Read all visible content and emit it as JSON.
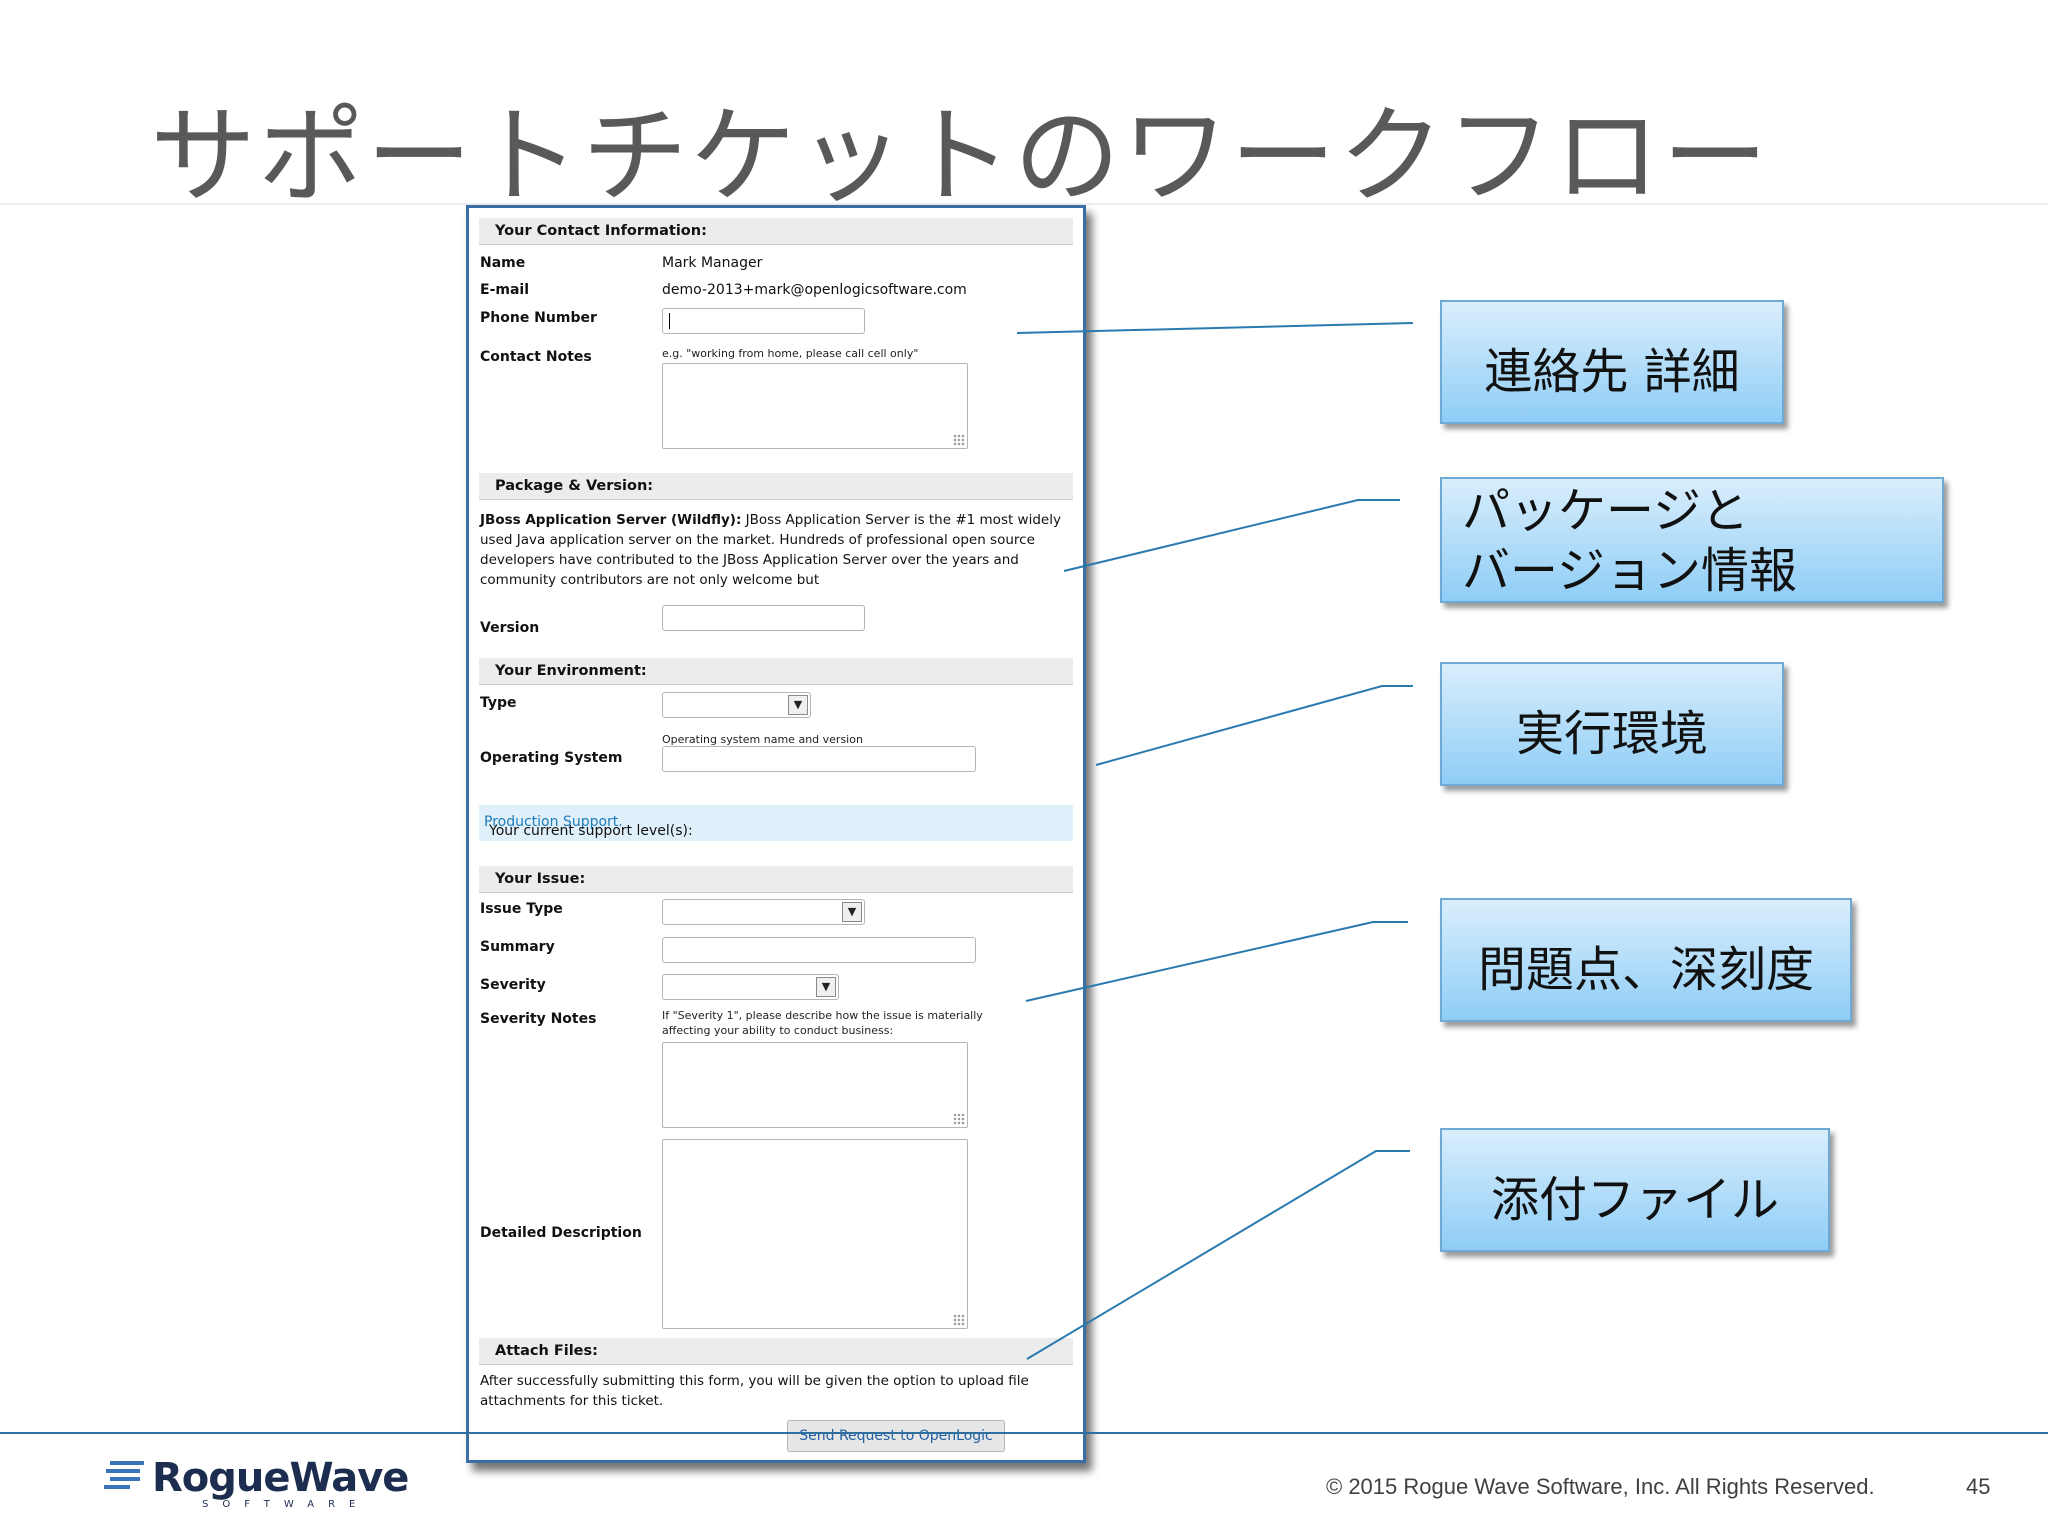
{
  "slide": {
    "title": "サポートチケットのワークフロー",
    "copyright": "© 2015 Rogue Wave Software, Inc. All Rights Reserved.",
    "page_number": "45",
    "logo": {
      "name": "RogueWave",
      "tagline": "SOFTWARE"
    }
  },
  "form": {
    "contact": {
      "heading": "Your Contact Information:",
      "name_label": "Name",
      "name_value": "Mark Manager",
      "email_label": "E-mail",
      "email_value": "demo-2013+mark@openlogicsoftware.com",
      "phone_label": "Phone Number",
      "phone_value": "",
      "notes_label": "Contact Notes",
      "notes_hint": "e.g. \"working from home, please call cell only\""
    },
    "package": {
      "heading": "Package & Version:",
      "name": "JBoss Application Server (Wildfly):",
      "description": "JBoss Application Server is the #1 most widely used Java application server on the market. Hundreds of professional open source developers have contributed to the JBoss Application Server over the years and community contributors are not only welcome but",
      "version_label": "Version",
      "version_value": ""
    },
    "environment": {
      "heading": "Your Environment:",
      "type_label": "Type",
      "type_value": "",
      "os_hint": "Operating system name and version",
      "os_label": "Operating System",
      "os_value": ""
    },
    "support": {
      "prefix": "Your current support level(s):",
      "level": "Production Support."
    },
    "issue": {
      "heading": "Your Issue:",
      "issue_type_label": "Issue Type",
      "summary_label": "Summary",
      "severity_label": "Severity",
      "severity_notes_label": "Severity Notes",
      "severity_notes_hint_1": "If \"Severity 1\", please describe how the issue is materially",
      "severity_notes_hint_2": "affecting your ability to conduct business:",
      "description_label": "Detailed Description"
    },
    "attach": {
      "heading": "Attach Files:",
      "text": "After successfully submitting this form, you will be given the option to upload file attachments for this ticket."
    },
    "submit_label": "Send Request to OpenLogic"
  },
  "callouts": {
    "contact": "連絡先 詳細",
    "package": "パッケージと\nバージョン情報",
    "environment": "実行環境",
    "issue": "問題点、深刻度",
    "attachments": "添付ファイル"
  },
  "colors": {
    "form_border": "#3a6ea5",
    "callout_top": "#d9eefc",
    "callout_bottom": "#8fcdf6",
    "connector": "#2a7ab0",
    "support_bar": "#dff0fb",
    "link": "#1f7ab8"
  }
}
